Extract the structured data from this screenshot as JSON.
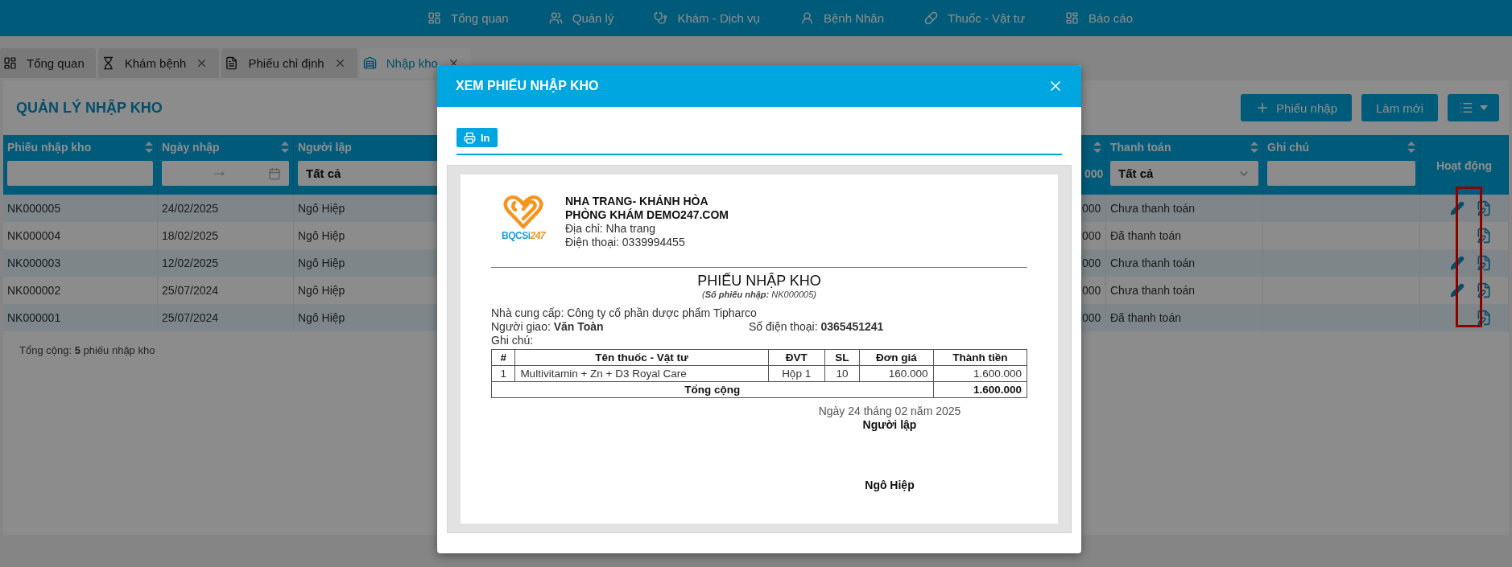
{
  "nav": [
    {
      "label": "Tổng quan"
    },
    {
      "label": "Quản lý"
    },
    {
      "label": "Khám - Dịch vụ"
    },
    {
      "label": "Bệnh Nhân"
    },
    {
      "label": "Thuốc - Vật tư"
    },
    {
      "label": "Báo cáo"
    }
  ],
  "tabs": [
    {
      "label": "Tổng quan",
      "closable": false,
      "selected": false
    },
    {
      "label": "Khám bệnh",
      "closable": true,
      "selected": false
    },
    {
      "label": "Phiếu chỉ định",
      "closable": true,
      "selected": false
    },
    {
      "label": "Nhập kho",
      "closable": true,
      "selected": true
    }
  ],
  "page": {
    "title": "QUẢN LÝ NHẬP KHO",
    "toolbar": [
      {
        "kind": "add",
        "label": "Phiếu nhập"
      },
      {
        "kind": "text",
        "label": "Làm mới"
      },
      {
        "kind": "columns"
      }
    ],
    "table": {
      "columns": [
        {
          "kind": "text",
          "label": "Phiếu nhập kho",
          "sortable": true
        },
        {
          "kind": "daterange",
          "label": "Ngày nhập",
          "sortable": true
        },
        {
          "kind": "select",
          "label": "Người lập",
          "filter_value": "Tất cả"
        },
        {
          "kind": "value",
          "sortable": true,
          "filter_value": "000"
        },
        {
          "kind": "select",
          "label": "Thanh toán",
          "sortable": true,
          "filter_value": "Tất cả"
        },
        {
          "kind": "text",
          "label": "Ghi chú",
          "sortable": true
        },
        {
          "kind": "actions",
          "label": "Hoạt động",
          "sortable": false
        }
      ],
      "rows": [
        {
          "code": "NK000005",
          "date": "24/02/2025",
          "creator": "Ngô Hiệp",
          "amount": "000",
          "payment": "Chưa thanh toán",
          "editable": true
        },
        {
          "code": "NK000004",
          "date": "18/02/2025",
          "creator": "Ngô Hiệp",
          "amount": "000",
          "payment": "Đã thanh toán",
          "editable": false
        },
        {
          "code": "NK000003",
          "date": "12/02/2025",
          "creator": "Ngô Hiệp",
          "amount": "000",
          "payment": "Chưa thanh toán",
          "editable": true
        },
        {
          "code": "NK000002",
          "date": "25/07/2024",
          "creator": "Ngô Hiệp",
          "amount": "000",
          "payment": "Chưa thanh toán",
          "editable": true
        },
        {
          "code": "NK000001",
          "date": "25/07/2024",
          "creator": "Ngô Hiệp",
          "amount": "000",
          "payment": "Đã thanh toán",
          "editable": false
        }
      ],
      "view_column_highlighted": true,
      "footer": "Tổng cộng: **5** phiếu nhập kho"
    }
  },
  "modal": {
    "title": "XEM PHIẾU NHẬP KHO",
    "print_label": "In",
    "receipt": {
      "logo_text": [
        "BQCSi",
        "247"
      ],
      "clinic": [
        "NHA TRANG- KHÁNH HÒA",
        "PHÒNG KHÁM DEMO247.COM"
      ],
      "address": "Địa chỉ: Nha trang",
      "phone": "Điện thoại: 0339994455",
      "title": "PHIẾU NHẬP KHO",
      "number": "(**Số phiếu nhập:** NK000005)",
      "supplier": "Nhà cung cấp: Công ty cổ phần dược phẩm Tipharco",
      "deliverer": "Người giao: **Văn Toàn**",
      "deliverer_phone": "Số điện thoại: **0365451241**",
      "note": "Ghi chú:",
      "columns": [
        "#",
        "Tên thuốc - Vật tư",
        "ĐVT",
        "SL",
        "Đơn giá",
        "Thành tiền"
      ],
      "items": [
        [
          "1",
          "Multivitamin + Zn + D3 Royal Care",
          "Hộp 1",
          "10",
          "160.000",
          "1.600.000"
        ]
      ],
      "total_label": "Tổng cộng",
      "total": "1.600.000",
      "date": "Ngày 24 tháng 02 năm 2025",
      "signer_role": "Người lập",
      "signer": "Ngô Hiệp"
    }
  }
}
